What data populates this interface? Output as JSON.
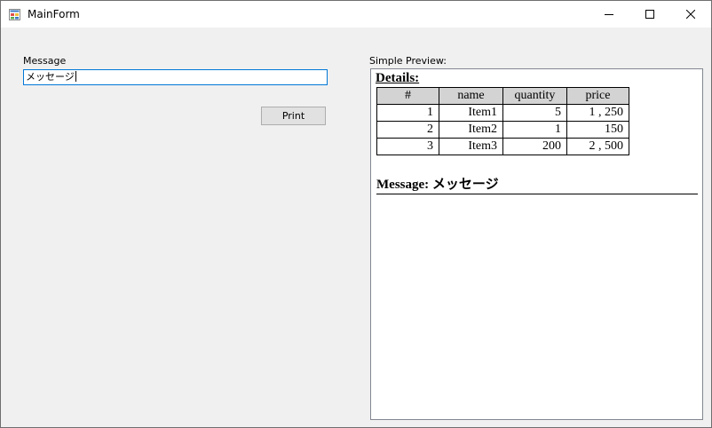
{
  "window": {
    "title": "MainForm"
  },
  "form": {
    "message_label": "Message",
    "message_value": "メッセージ",
    "print_label": "Print",
    "preview_label": "Simple Preview:"
  },
  "preview": {
    "details_title": "Details:",
    "table": {
      "headers": [
        "#",
        "name",
        "quantity",
        "price"
      ],
      "rows": [
        [
          "1",
          "Item1",
          "5",
          "1 , 250"
        ],
        [
          "2",
          "Item2",
          "1",
          "150"
        ],
        [
          "3",
          "Item3",
          "200",
          "2 , 500"
        ]
      ]
    },
    "message_text": "Message: メッセージ"
  }
}
